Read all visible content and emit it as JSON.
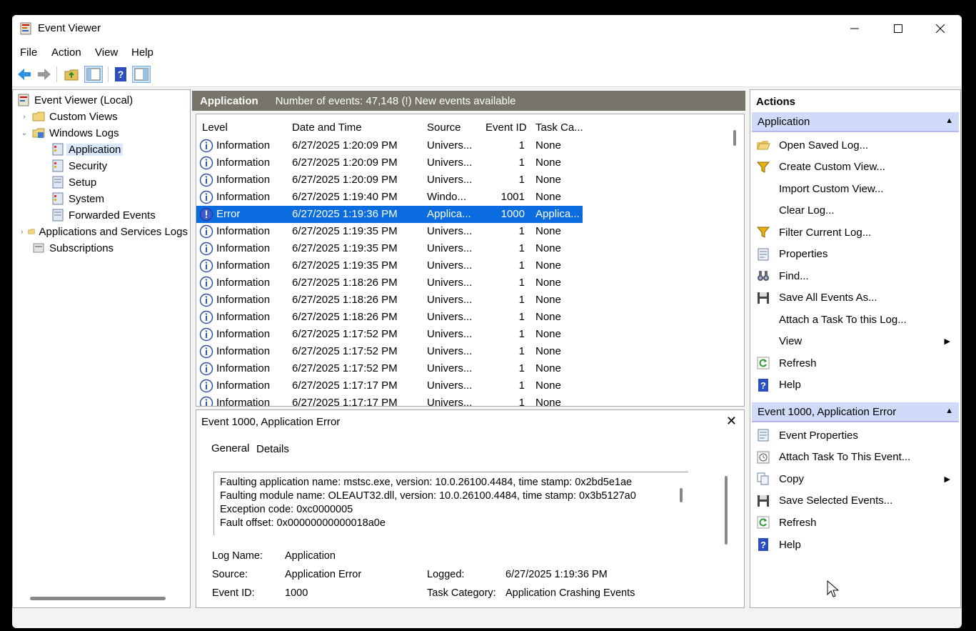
{
  "window": {
    "title": "Event Viewer"
  },
  "menu": [
    "File",
    "Action",
    "View",
    "Help"
  ],
  "tree": {
    "root": "Event Viewer (Local)",
    "items": [
      {
        "label": "Custom Views",
        "level": 1,
        "expander": "›"
      },
      {
        "label": "Windows Logs",
        "level": 1,
        "expander": "⌄"
      },
      {
        "label": "Application",
        "level": 2,
        "selected": true
      },
      {
        "label": "Security",
        "level": 2
      },
      {
        "label": "Setup",
        "level": 2
      },
      {
        "label": "System",
        "level": 2
      },
      {
        "label": "Forwarded Events",
        "level": 2
      },
      {
        "label": "Applications and Services Logs",
        "level": 1,
        "expander": "›"
      },
      {
        "label": "Subscriptions",
        "level": 1
      }
    ]
  },
  "center": {
    "log_name": "Application",
    "summary": "Number of events: 47,148 (!) New events available",
    "columns": [
      "Level",
      "Date and Time",
      "Source",
      "Event ID",
      "Task Ca..."
    ],
    "rows": [
      {
        "level": "Information",
        "datetime": "6/27/2025 1:20:09 PM",
        "source": "Univers...",
        "event_id": "1",
        "task": "None"
      },
      {
        "level": "Information",
        "datetime": "6/27/2025 1:20:09 PM",
        "source": "Univers...",
        "event_id": "1",
        "task": "None"
      },
      {
        "level": "Information",
        "datetime": "6/27/2025 1:20:09 PM",
        "source": "Univers...",
        "event_id": "1",
        "task": "None"
      },
      {
        "level": "Information",
        "datetime": "6/27/2025 1:19:40 PM",
        "source": "Windo...",
        "event_id": "1001",
        "task": "None"
      },
      {
        "level": "Error",
        "datetime": "6/27/2025 1:19:36 PM",
        "source": "Applica...",
        "event_id": "1000",
        "task": "Applica...",
        "selected": true
      },
      {
        "level": "Information",
        "datetime": "6/27/2025 1:19:35 PM",
        "source": "Univers...",
        "event_id": "1",
        "task": "None"
      },
      {
        "level": "Information",
        "datetime": "6/27/2025 1:19:35 PM",
        "source": "Univers...",
        "event_id": "1",
        "task": "None"
      },
      {
        "level": "Information",
        "datetime": "6/27/2025 1:19:35 PM",
        "source": "Univers...",
        "event_id": "1",
        "task": "None"
      },
      {
        "level": "Information",
        "datetime": "6/27/2025 1:18:26 PM",
        "source": "Univers...",
        "event_id": "1",
        "task": "None"
      },
      {
        "level": "Information",
        "datetime": "6/27/2025 1:18:26 PM",
        "source": "Univers...",
        "event_id": "1",
        "task": "None"
      },
      {
        "level": "Information",
        "datetime": "6/27/2025 1:18:26 PM",
        "source": "Univers...",
        "event_id": "1",
        "task": "None"
      },
      {
        "level": "Information",
        "datetime": "6/27/2025 1:17:52 PM",
        "source": "Univers...",
        "event_id": "1",
        "task": "None"
      },
      {
        "level": "Information",
        "datetime": "6/27/2025 1:17:52 PM",
        "source": "Univers...",
        "event_id": "1",
        "task": "None"
      },
      {
        "level": "Information",
        "datetime": "6/27/2025 1:17:52 PM",
        "source": "Univers...",
        "event_id": "1",
        "task": "None"
      },
      {
        "level": "Information",
        "datetime": "6/27/2025 1:17:17 PM",
        "source": "Univers...",
        "event_id": "1",
        "task": "None"
      },
      {
        "level": "Information",
        "datetime": "6/27/2025 1:17:17 PM",
        "source": "Univers...",
        "event_id": "1",
        "task": "None"
      }
    ]
  },
  "detail": {
    "title": "Event 1000, Application Error",
    "tabs": [
      "General",
      "Details"
    ],
    "message": [
      "Faulting application name: mstsc.exe, version: 10.0.26100.4484, time stamp: 0x2bd5e1ae",
      "Faulting module name: OLEAUT32.dll, version: 10.0.26100.4484, time stamp: 0x3b5127a0",
      "Exception code: 0xc0000005",
      "Fault offset: 0x00000000000018a0e"
    ],
    "log_name_label": "Log Name:",
    "log_name": "Application",
    "source_label": "Source:",
    "source": "Application Error",
    "logged_label": "Logged:",
    "logged": "6/27/2025 1:19:36 PM",
    "event_id_label": "Event ID:",
    "event_id": "1000",
    "task_label": "Task Category:",
    "task": "Application Crashing Events"
  },
  "actions": {
    "title": "Actions",
    "group1": {
      "label": "Application",
      "items": [
        {
          "label": "Open Saved Log...",
          "icon": "folder-open-icon"
        },
        {
          "label": "Create Custom View...",
          "icon": "filter-icon"
        },
        {
          "label": "Import Custom View...",
          "icon": ""
        },
        {
          "label": "Clear Log...",
          "icon": ""
        },
        {
          "label": "Filter Current Log...",
          "icon": "filter-icon"
        },
        {
          "label": "Properties",
          "icon": "properties-icon"
        },
        {
          "label": "Find...",
          "icon": "binoculars-icon"
        },
        {
          "label": "Save All Events As...",
          "icon": "save-icon"
        },
        {
          "label": "Attach a Task To this Log...",
          "icon": ""
        },
        {
          "label": "View",
          "icon": "",
          "submenu": true
        },
        {
          "label": "Refresh",
          "icon": "refresh-icon"
        },
        {
          "label": "Help",
          "icon": "help-icon"
        }
      ]
    },
    "group2": {
      "label": "Event 1000, Application Error",
      "items": [
        {
          "label": "Event Properties",
          "icon": "properties-icon"
        },
        {
          "label": "Attach Task To This Event...",
          "icon": "task-icon"
        },
        {
          "label": "Copy",
          "icon": "copy-icon",
          "submenu": true
        },
        {
          "label": "Save Selected Events...",
          "icon": "save-icon"
        },
        {
          "label": "Refresh",
          "icon": "refresh-icon"
        },
        {
          "label": "Help",
          "icon": "help-icon"
        }
      ]
    }
  },
  "colors": {
    "selection": "#0a6cde",
    "header_bar": "#77756a",
    "action_group": "#cfdbf8"
  }
}
